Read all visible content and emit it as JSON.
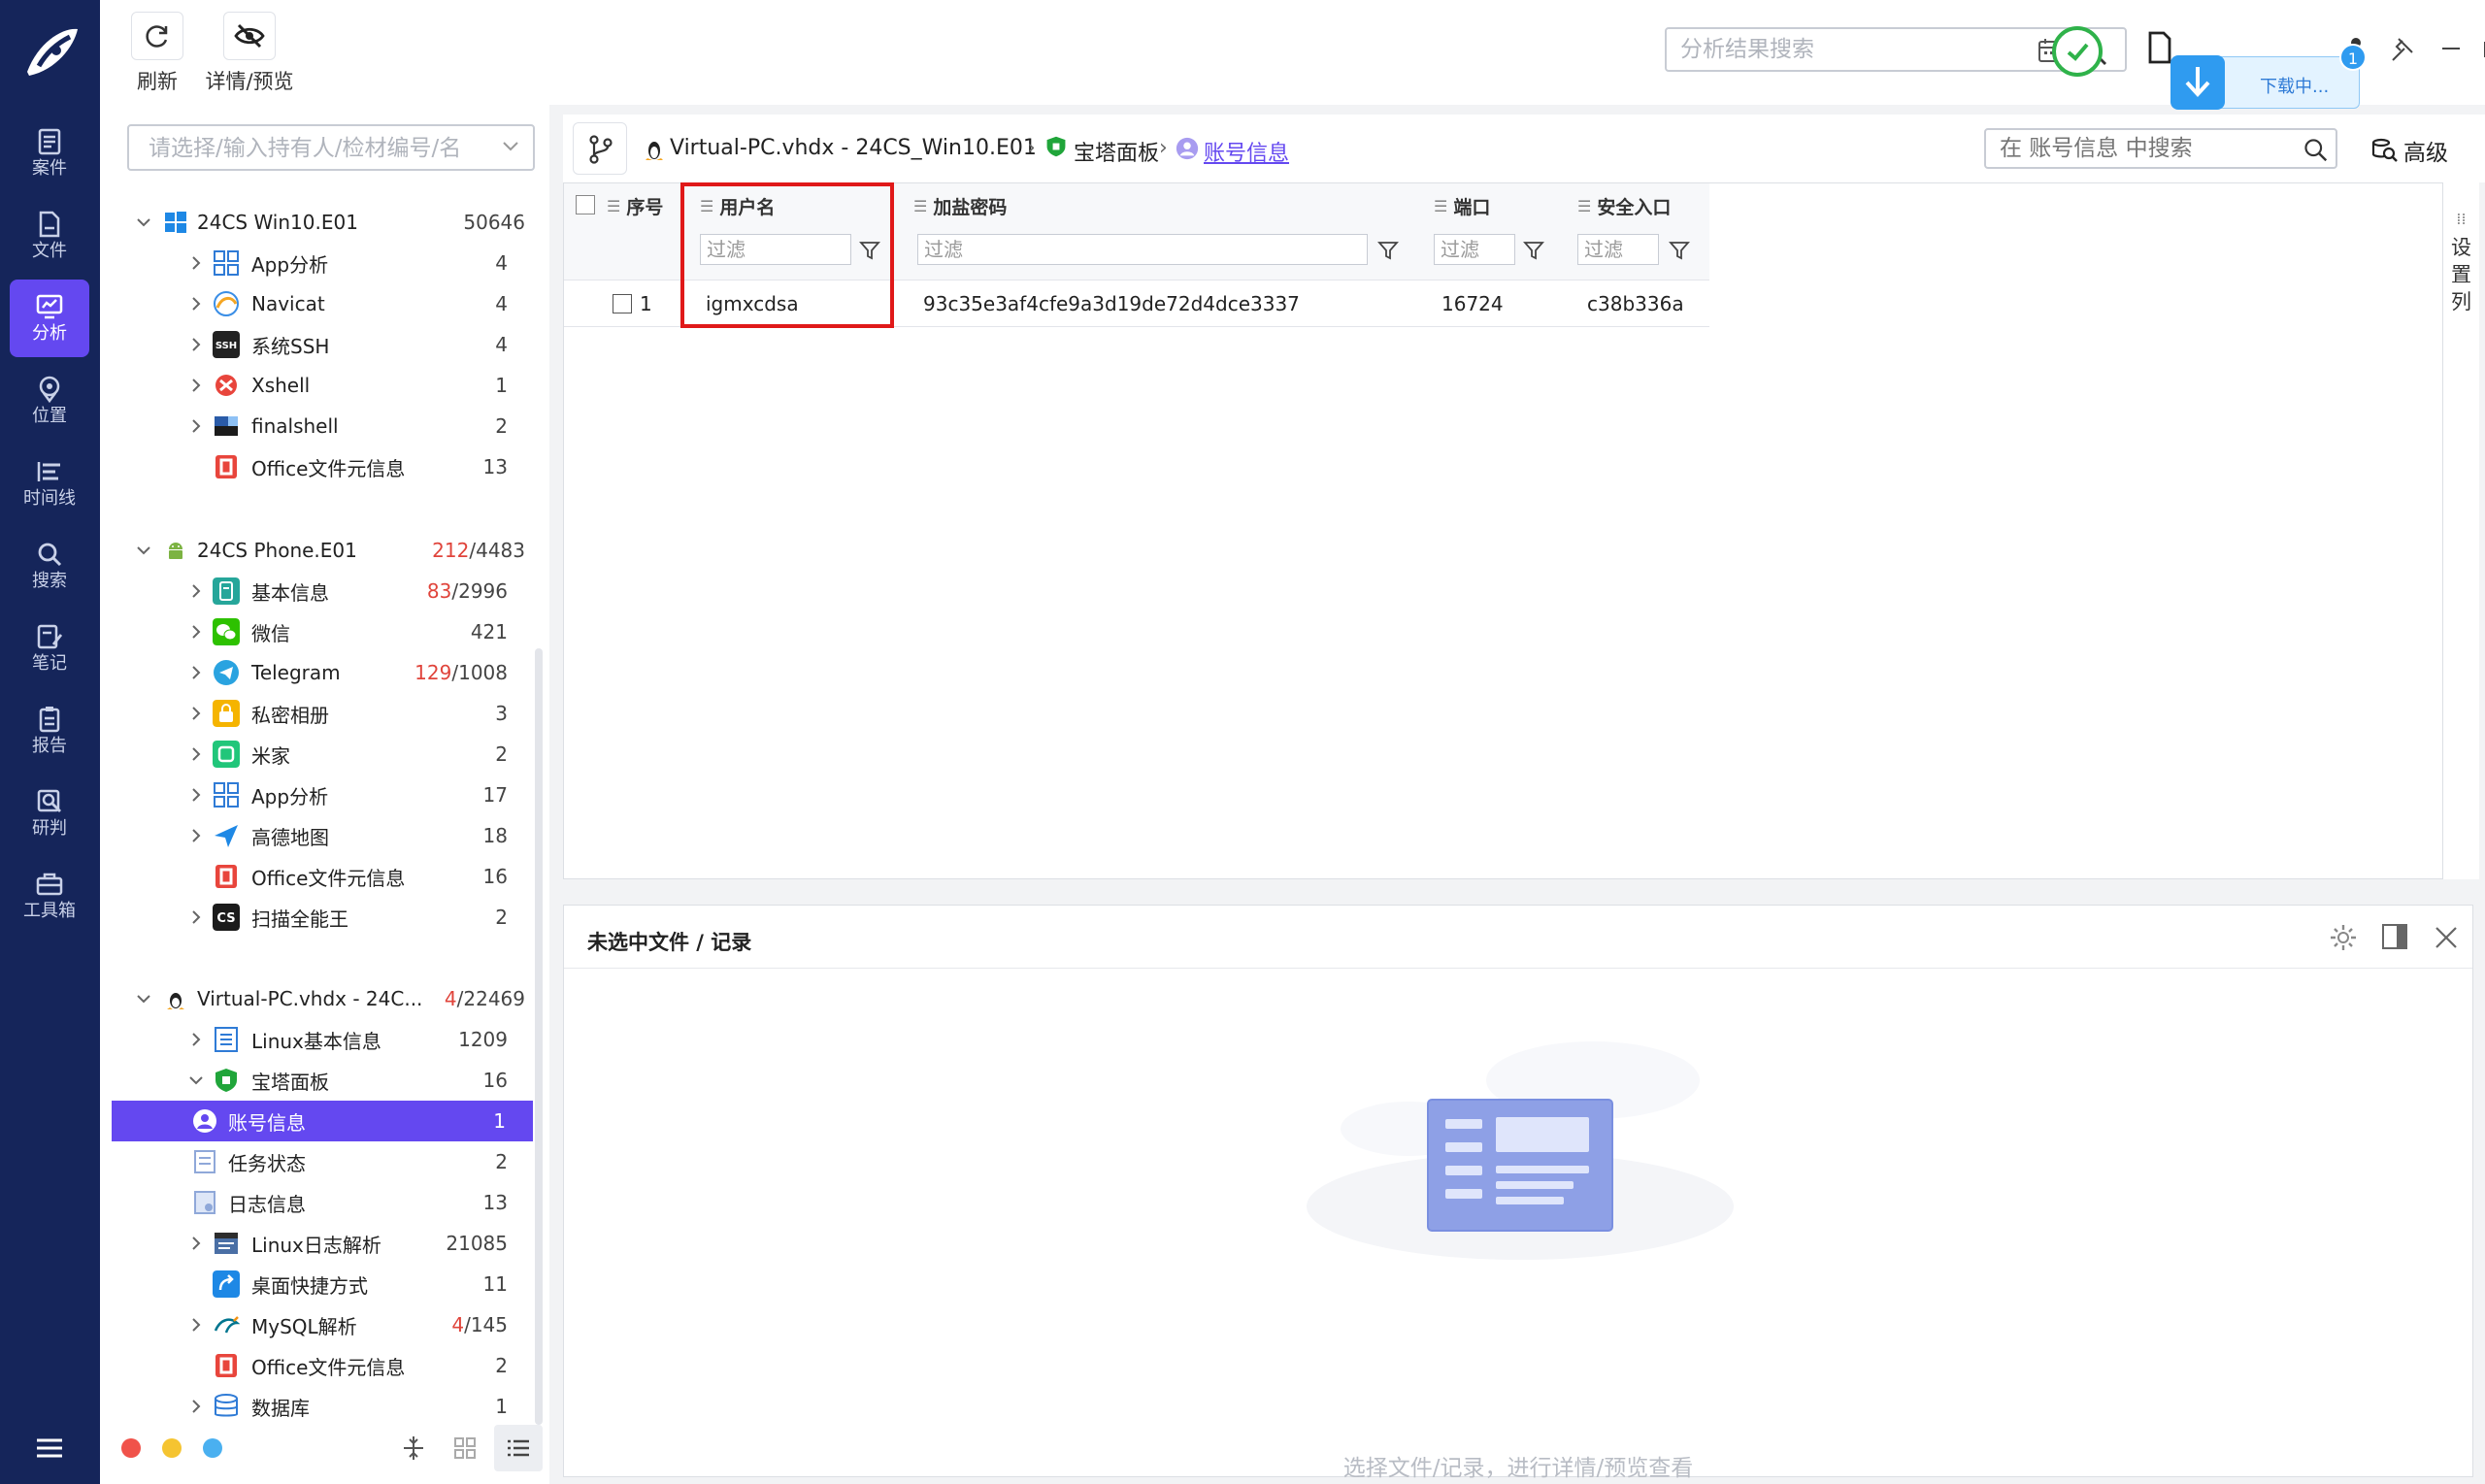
{
  "nav": {
    "items": [
      {
        "label": "案件",
        "icon": "case-icon"
      },
      {
        "label": "文件",
        "icon": "file-icon"
      },
      {
        "label": "分析",
        "icon": "analysis-icon"
      },
      {
        "label": "位置",
        "icon": "location-icon"
      },
      {
        "label": "时间线",
        "icon": "timeline-icon"
      },
      {
        "label": "搜索",
        "icon": "search-icon"
      },
      {
        "label": "笔记",
        "icon": "note-icon"
      },
      {
        "label": "报告",
        "icon": "report-icon"
      },
      {
        "label": "研判",
        "icon": "judge-icon"
      },
      {
        "label": "工具箱",
        "icon": "toolbox-icon"
      }
    ],
    "active_index": 2
  },
  "toolbar": {
    "refresh_label": "刷新",
    "detail_label": "详情/预览",
    "search_placeholder": "分析结果搜索",
    "download_label": "下载中...",
    "download_badge": "1"
  },
  "sidebar": {
    "filter_placeholder": "请选择/输入持有人/检材编号/名",
    "groups": [
      {
        "title": "24CS Win10.E01",
        "count": "50646",
        "items": [
          {
            "label": "App分析",
            "count": "4"
          },
          {
            "label": "Navicat",
            "count": "4"
          },
          {
            "label": "系统SSH",
            "count": "4"
          },
          {
            "label": "Xshell",
            "count": "1"
          },
          {
            "label": "finalshell",
            "count": "2"
          },
          {
            "label": "Office文件元信息",
            "count": "13"
          }
        ]
      },
      {
        "title": "24CS Phone.E01",
        "count_red": "212",
        "count": "/4483",
        "items": [
          {
            "label": "基本信息",
            "count_red": "83",
            "count": "/2996"
          },
          {
            "label": "微信",
            "count": "421"
          },
          {
            "label": "Telegram",
            "count_red": "129",
            "count": "/1008"
          },
          {
            "label": "私密相册",
            "count": "3"
          },
          {
            "label": "米家",
            "count": "2"
          },
          {
            "label": "App分析",
            "count": "17"
          },
          {
            "label": "高德地图",
            "count": "18"
          },
          {
            "label": "Office文件元信息",
            "count": "16"
          },
          {
            "label": "扫描全能王",
            "count": "2"
          }
        ]
      },
      {
        "title": "Virtual-PC.vhdx - 24C...",
        "count_red": "4",
        "count": "/22469",
        "items": [
          {
            "label": "Linux基本信息",
            "count": "1209"
          },
          {
            "label": "宝塔面板",
            "count": "16"
          },
          {
            "label": "账号信息",
            "count": "1"
          },
          {
            "label": "任务状态",
            "count": "2"
          },
          {
            "label": "日志信息",
            "count": "13"
          },
          {
            "label": "Linux日志解析",
            "count": "21085"
          },
          {
            "label": "桌面快捷方式",
            "count": "11"
          },
          {
            "label": "MySQL解析",
            "count_red": "4",
            "count": "/145"
          },
          {
            "label": "Office文件元信息",
            "count": "2"
          },
          {
            "label": "数据库",
            "count": "1"
          }
        ]
      }
    ]
  },
  "breadcrumb": {
    "items": [
      "Virtual-PC.vhdx - 24CS_Win10.E01",
      "宝塔面板",
      "账号信息"
    ],
    "search_placeholder": "在 账号信息 中搜索",
    "advanced_label": "高级"
  },
  "table": {
    "columns": [
      "序号",
      "用户名",
      "加盐密码",
      "端口",
      "安全入口"
    ],
    "filter_placeholder": "过滤",
    "rows": [
      {
        "index": "1",
        "username": "igmxcdsa",
        "salted_password": "93c35e3af4cfe9a3d19de72d4dce3337",
        "port": "16724",
        "entry": "c38b336a"
      }
    ],
    "settings_label": "设置列"
  },
  "detail": {
    "title": "未选中文件 / 记录",
    "empty_text": "选择文件/记录，进行详情/预览查看"
  },
  "colors": {
    "nav_bg": "#15255a",
    "accent": "#6448f0",
    "highlight_border": "#e01919"
  }
}
